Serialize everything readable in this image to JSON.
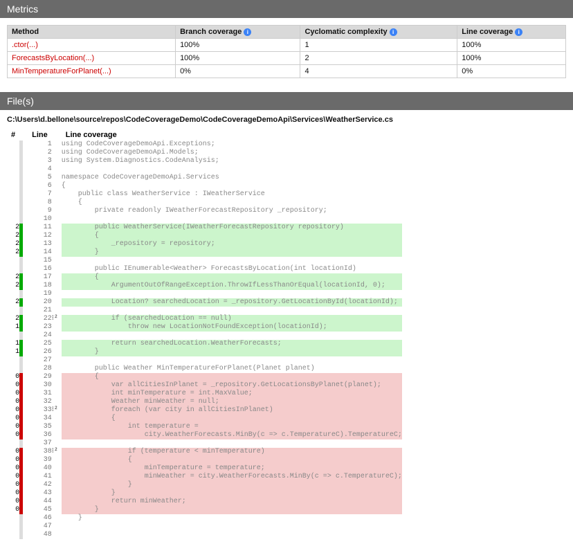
{
  "sections": {
    "metrics_title": "Metrics",
    "files_title": "File(s)"
  },
  "metrics": {
    "columns": {
      "method": "Method",
      "branch": "Branch coverage",
      "cyclo": "Cyclomatic complexity",
      "line": "Line coverage"
    },
    "rows": [
      {
        "method": ".ctor(...)",
        "branch": "100%",
        "cyclo": "1",
        "line": "100%"
      },
      {
        "method": "ForecastsByLocation(...)",
        "branch": "100%",
        "cyclo": "2",
        "line": "100%"
      },
      {
        "method": "MinTemperatureForPlanet(...)",
        "branch": "0%",
        "cyclo": "4",
        "line": "0%"
      }
    ]
  },
  "file_path": "C:\\Users\\d.bellone\\source\\repos\\CodeCoverageDemo\\CodeCoverageDemoApi\\Services\\WeatherService.cs",
  "code_header": {
    "count": "#",
    "line": "Line",
    "cov": "Line coverage"
  },
  "code_lines": [
    {
      "n": 1,
      "count": "",
      "bar": "gray",
      "branch": "",
      "cov": "",
      "text": "using CodeCoverageDemoApi.Exceptions;"
    },
    {
      "n": 2,
      "count": "",
      "bar": "gray",
      "branch": "",
      "cov": "",
      "text": "using CodeCoverageDemoApi.Models;"
    },
    {
      "n": 3,
      "count": "",
      "bar": "gray",
      "branch": "",
      "cov": "",
      "text": "using System.Diagnostics.CodeAnalysis;"
    },
    {
      "n": 4,
      "count": "",
      "bar": "gray",
      "branch": "",
      "cov": "",
      "text": ""
    },
    {
      "n": 5,
      "count": "",
      "bar": "gray",
      "branch": "",
      "cov": "",
      "text": "namespace CodeCoverageDemoApi.Services"
    },
    {
      "n": 6,
      "count": "",
      "bar": "gray",
      "branch": "",
      "cov": "",
      "text": "{"
    },
    {
      "n": 7,
      "count": "",
      "bar": "gray",
      "branch": "",
      "cov": "",
      "text": "    public class WeatherService : IWeatherService"
    },
    {
      "n": 8,
      "count": "",
      "bar": "gray",
      "branch": "",
      "cov": "",
      "text": "    {"
    },
    {
      "n": 9,
      "count": "",
      "bar": "gray",
      "branch": "",
      "cov": "",
      "text": "        private readonly IWeatherForecastRepository _repository;"
    },
    {
      "n": 10,
      "count": "",
      "bar": "gray",
      "branch": "",
      "cov": "",
      "text": ""
    },
    {
      "n": 11,
      "count": "2",
      "bar": "green",
      "branch": "",
      "cov": "covered",
      "text": "        public WeatherService(IWeatherForecastRepository repository)"
    },
    {
      "n": 12,
      "count": "2",
      "bar": "green",
      "branch": "",
      "cov": "covered",
      "text": "        {"
    },
    {
      "n": 13,
      "count": "2",
      "bar": "green",
      "branch": "",
      "cov": "covered",
      "text": "            _repository = repository;"
    },
    {
      "n": 14,
      "count": "2",
      "bar": "green",
      "branch": "",
      "cov": "covered",
      "text": "        }"
    },
    {
      "n": 15,
      "count": "",
      "bar": "gray",
      "branch": "",
      "cov": "",
      "text": ""
    },
    {
      "n": 16,
      "count": "",
      "bar": "gray",
      "branch": "",
      "cov": "",
      "text": "        public IEnumerable<Weather> ForecastsByLocation(int locationId)"
    },
    {
      "n": 17,
      "count": "2",
      "bar": "green",
      "branch": "",
      "cov": "covered",
      "text": "        {"
    },
    {
      "n": 18,
      "count": "2",
      "bar": "green",
      "branch": "",
      "cov": "covered",
      "text": "            ArgumentOutOfRangeException.ThrowIfLessThanOrEqual(locationId, 0);"
    },
    {
      "n": 19,
      "count": "",
      "bar": "gray",
      "branch": "",
      "cov": "",
      "text": ""
    },
    {
      "n": 20,
      "count": "2",
      "bar": "green",
      "branch": "",
      "cov": "covered",
      "text": "            Location? searchedLocation = _repository.GetLocationById(locationId);"
    },
    {
      "n": 21,
      "count": "",
      "bar": "gray",
      "branch": "",
      "cov": "",
      "text": ""
    },
    {
      "n": 22,
      "count": "2",
      "bar": "green",
      "branch": "⁝²",
      "cov": "covered",
      "text": "            if (searchedLocation == null)"
    },
    {
      "n": 23,
      "count": "1",
      "bar": "green",
      "branch": "",
      "cov": "covered",
      "text": "                throw new LocationNotFoundException(locationId);"
    },
    {
      "n": 24,
      "count": "",
      "bar": "gray",
      "branch": "",
      "cov": "",
      "text": ""
    },
    {
      "n": 25,
      "count": "1",
      "bar": "green",
      "branch": "",
      "cov": "covered",
      "text": "            return searchedLocation.WeatherForecasts;"
    },
    {
      "n": 26,
      "count": "1",
      "bar": "green",
      "branch": "",
      "cov": "covered",
      "text": "        }"
    },
    {
      "n": 27,
      "count": "",
      "bar": "gray",
      "branch": "",
      "cov": "",
      "text": ""
    },
    {
      "n": 28,
      "count": "",
      "bar": "gray",
      "branch": "",
      "cov": "",
      "text": "        public Weather MinTemperatureForPlanet(Planet planet)"
    },
    {
      "n": 29,
      "count": "0",
      "bar": "red",
      "branch": "",
      "cov": "uncovered",
      "text": "        {"
    },
    {
      "n": 30,
      "count": "0",
      "bar": "red",
      "branch": "",
      "cov": "uncovered",
      "text": "            var allCitiesInPlanet = _repository.GetLocationsByPlanet(planet);"
    },
    {
      "n": 31,
      "count": "0",
      "bar": "red",
      "branch": "",
      "cov": "uncovered",
      "text": "            int minTemperature = int.MaxValue;"
    },
    {
      "n": 32,
      "count": "0",
      "bar": "red",
      "branch": "",
      "cov": "uncovered",
      "text": "            Weather minWeather = null;"
    },
    {
      "n": 33,
      "count": "0",
      "bar": "red",
      "branch": "⁝²",
      "cov": "uncovered",
      "text": "            foreach (var city in allCitiesInPlanet)"
    },
    {
      "n": 34,
      "count": "0",
      "bar": "red",
      "branch": "",
      "cov": "uncovered",
      "text": "            {"
    },
    {
      "n": 35,
      "count": "0",
      "bar": "red",
      "branch": "",
      "cov": "uncovered",
      "text": "                int temperature ="
    },
    {
      "n": 36,
      "count": "0",
      "bar": "red",
      "branch": "",
      "cov": "uncovered",
      "text": "                    city.WeatherForecasts.MinBy(c => c.TemperatureC).TemperatureC;"
    },
    {
      "n": 37,
      "count": "",
      "bar": "gray",
      "branch": "",
      "cov": "",
      "text": ""
    },
    {
      "n": 38,
      "count": "0",
      "bar": "red",
      "branch": "⁝²",
      "cov": "uncovered",
      "text": "                if (temperature < minTemperature)"
    },
    {
      "n": 39,
      "count": "0",
      "bar": "red",
      "branch": "",
      "cov": "uncovered",
      "text": "                {"
    },
    {
      "n": 40,
      "count": "0",
      "bar": "red",
      "branch": "",
      "cov": "uncovered",
      "text": "                    minTemperature = temperature;"
    },
    {
      "n": 41,
      "count": "0",
      "bar": "red",
      "branch": "",
      "cov": "uncovered",
      "text": "                    minWeather = city.WeatherForecasts.MinBy(c => c.TemperatureC);"
    },
    {
      "n": 42,
      "count": "0",
      "bar": "red",
      "branch": "",
      "cov": "uncovered",
      "text": "                }"
    },
    {
      "n": 43,
      "count": "0",
      "bar": "red",
      "branch": "",
      "cov": "uncovered",
      "text": "            }"
    },
    {
      "n": 44,
      "count": "0",
      "bar": "red",
      "branch": "",
      "cov": "uncovered",
      "text": "            return minWeather;"
    },
    {
      "n": 45,
      "count": "0",
      "bar": "red",
      "branch": "",
      "cov": "uncovered",
      "text": "        }"
    },
    {
      "n": 46,
      "count": "",
      "bar": "gray",
      "branch": "",
      "cov": "",
      "text": "    }"
    },
    {
      "n": 47,
      "count": "",
      "bar": "gray",
      "branch": "",
      "cov": "",
      "text": ""
    },
    {
      "n": 48,
      "count": "",
      "bar": "gray",
      "branch": "",
      "cov": "",
      "text": ""
    }
  ]
}
